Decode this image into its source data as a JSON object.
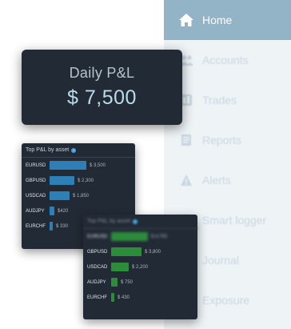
{
  "sidebar": {
    "items": [
      {
        "label": "Home",
        "icon": "home-icon",
        "active": true
      },
      {
        "label": "Accounts",
        "icon": "accounts-icon"
      },
      {
        "label": "Trades",
        "icon": "trades-icon"
      },
      {
        "label": "Reports",
        "icon": "reports-icon"
      },
      {
        "label": "Alerts",
        "icon": "alerts-icon"
      },
      {
        "label": "Smart logger",
        "icon": "smart-logger-icon"
      },
      {
        "label": "Journal",
        "icon": "journal-icon"
      },
      {
        "label": "Exposure",
        "icon": "exposure-icon"
      }
    ],
    "active_color": "#93b3c7",
    "background_color": "#eef3f6"
  },
  "daily_pl": {
    "title": "Daily P&L",
    "value": "$ 7,500"
  },
  "top_pl_by_asset": {
    "title": "Top P&L by asset",
    "bar_color": "#2e7fb6",
    "rows": [
      {
        "symbol": "EURUSD",
        "amount": "$ 3,500",
        "value": 3500
      },
      {
        "symbol": "GBPUSD",
        "amount": "$ 2,300",
        "value": 2300
      },
      {
        "symbol": "USDCAD",
        "amount": "$ 1,850",
        "value": 1850
      },
      {
        "symbol": "AUDJPY",
        "amount": "$420",
        "value": 420
      },
      {
        "symbol": "EURCHF",
        "amount": "$ 330",
        "value": 330
      }
    ]
  },
  "second_card": {
    "title": "Top P&L by asset",
    "bar_color": "#2c8c3c",
    "rows": [
      {
        "symbol": "EURUSD",
        "amount": "$ 4,700",
        "value": 4700
      },
      {
        "symbol": "GBPUSD",
        "amount": "$ 3,800",
        "value": 3800
      },
      {
        "symbol": "USDCAD",
        "amount": "$ 2,200",
        "value": 2200
      },
      {
        "symbol": "AUDJPY",
        "amount": "$ 750",
        "value": 750
      },
      {
        "symbol": "EURCHF",
        "amount": "$ 430",
        "value": 430
      }
    ]
  }
}
